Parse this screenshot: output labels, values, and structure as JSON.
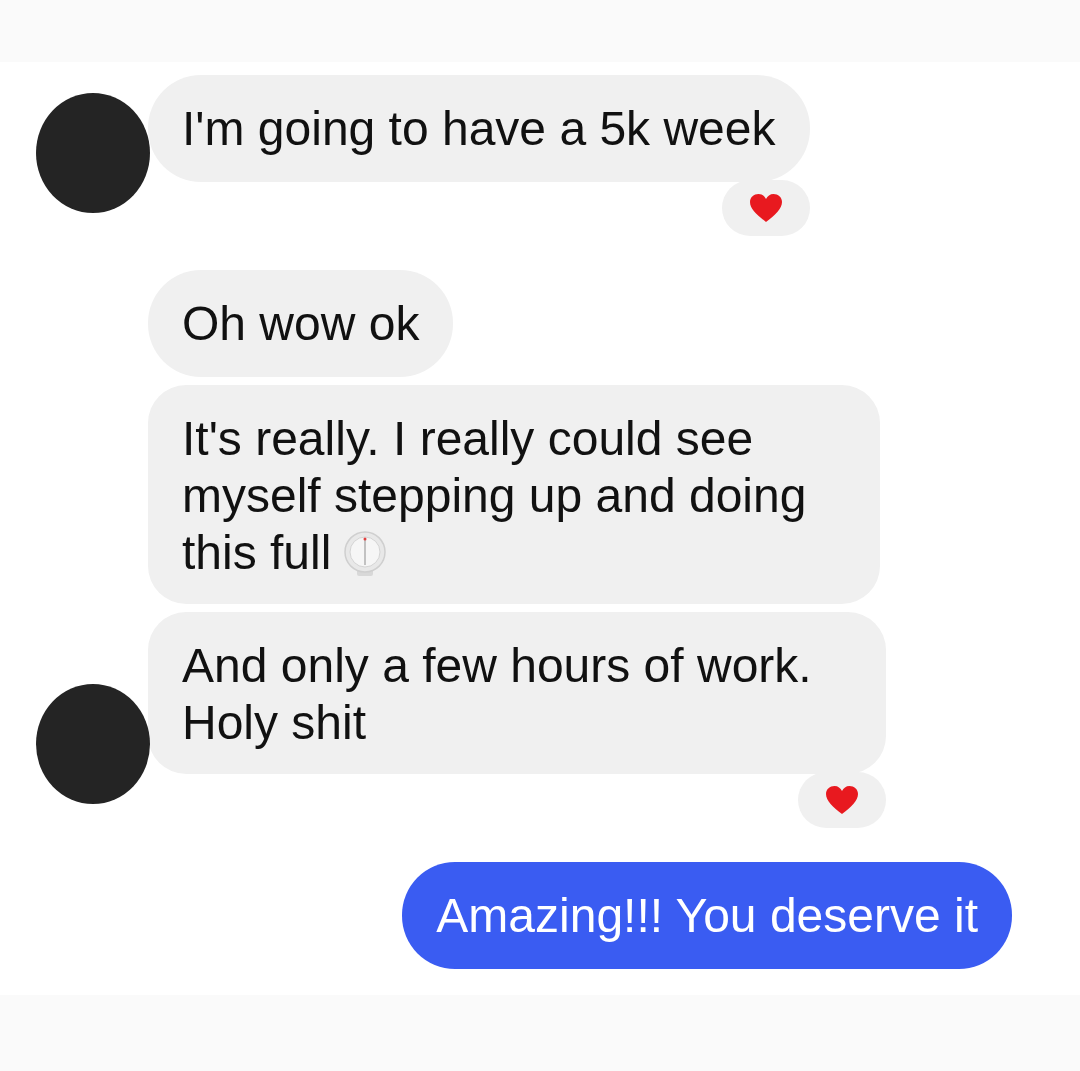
{
  "messages": [
    {
      "kind": "received",
      "avatar": true,
      "text": "I'm going to have a 5k week",
      "trailing_icon": false,
      "reaction": true
    },
    {
      "kind": "received",
      "avatar": false,
      "text": "Oh wow ok",
      "trailing_icon": false,
      "reaction": false
    },
    {
      "kind": "received",
      "avatar": false,
      "text": "It's really. I really could see\nmyself stepping up and doing\nthis full",
      "trailing_icon": true,
      "reaction": false
    },
    {
      "kind": "received",
      "avatar": true,
      "text": "And only a few hours of work.\nHoly shit",
      "trailing_icon": false,
      "reaction": true
    },
    {
      "kind": "sent",
      "text": "Amazing!!! You deserve it",
      "trailing_icon": false,
      "reaction": false
    }
  ]
}
